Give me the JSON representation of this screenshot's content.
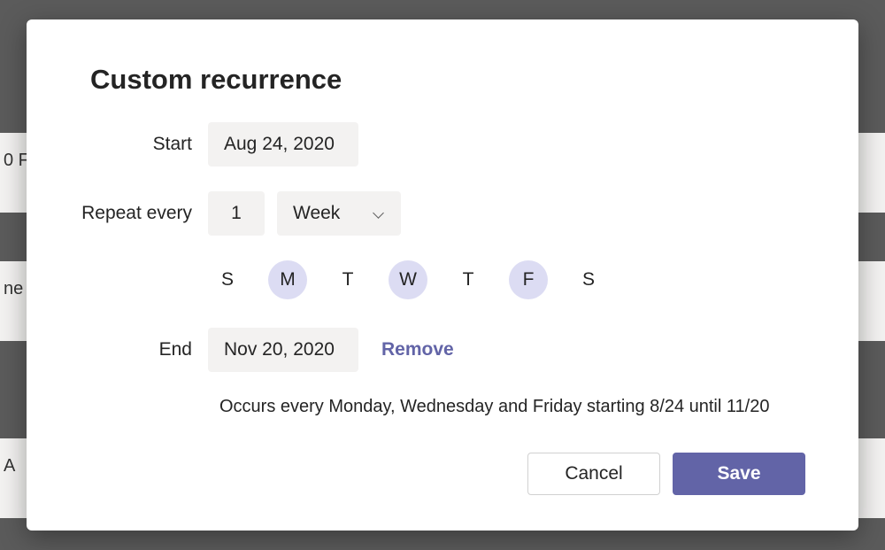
{
  "dialog": {
    "title": "Custom recurrence",
    "start": {
      "label": "Start",
      "value": "Aug 24, 2020"
    },
    "repeat": {
      "label": "Repeat every",
      "interval": "1",
      "unit": "Week"
    },
    "days": [
      {
        "letter": "S",
        "selected": false
      },
      {
        "letter": "M",
        "selected": true
      },
      {
        "letter": "T",
        "selected": false
      },
      {
        "letter": "W",
        "selected": true
      },
      {
        "letter": "T",
        "selected": false
      },
      {
        "letter": "F",
        "selected": true
      },
      {
        "letter": "S",
        "selected": false
      }
    ],
    "end": {
      "label": "End",
      "value": "Nov 20, 2020",
      "remove_label": "Remove"
    },
    "summary": "Occurs every Monday, Wednesday and Friday starting 8/24 until 11/20",
    "buttons": {
      "cancel": "Cancel",
      "save": "Save"
    }
  },
  "colors": {
    "accent": "#6264a7",
    "selected_day_bg": "#dcdcf3",
    "field_bg": "#f3f2f1"
  }
}
